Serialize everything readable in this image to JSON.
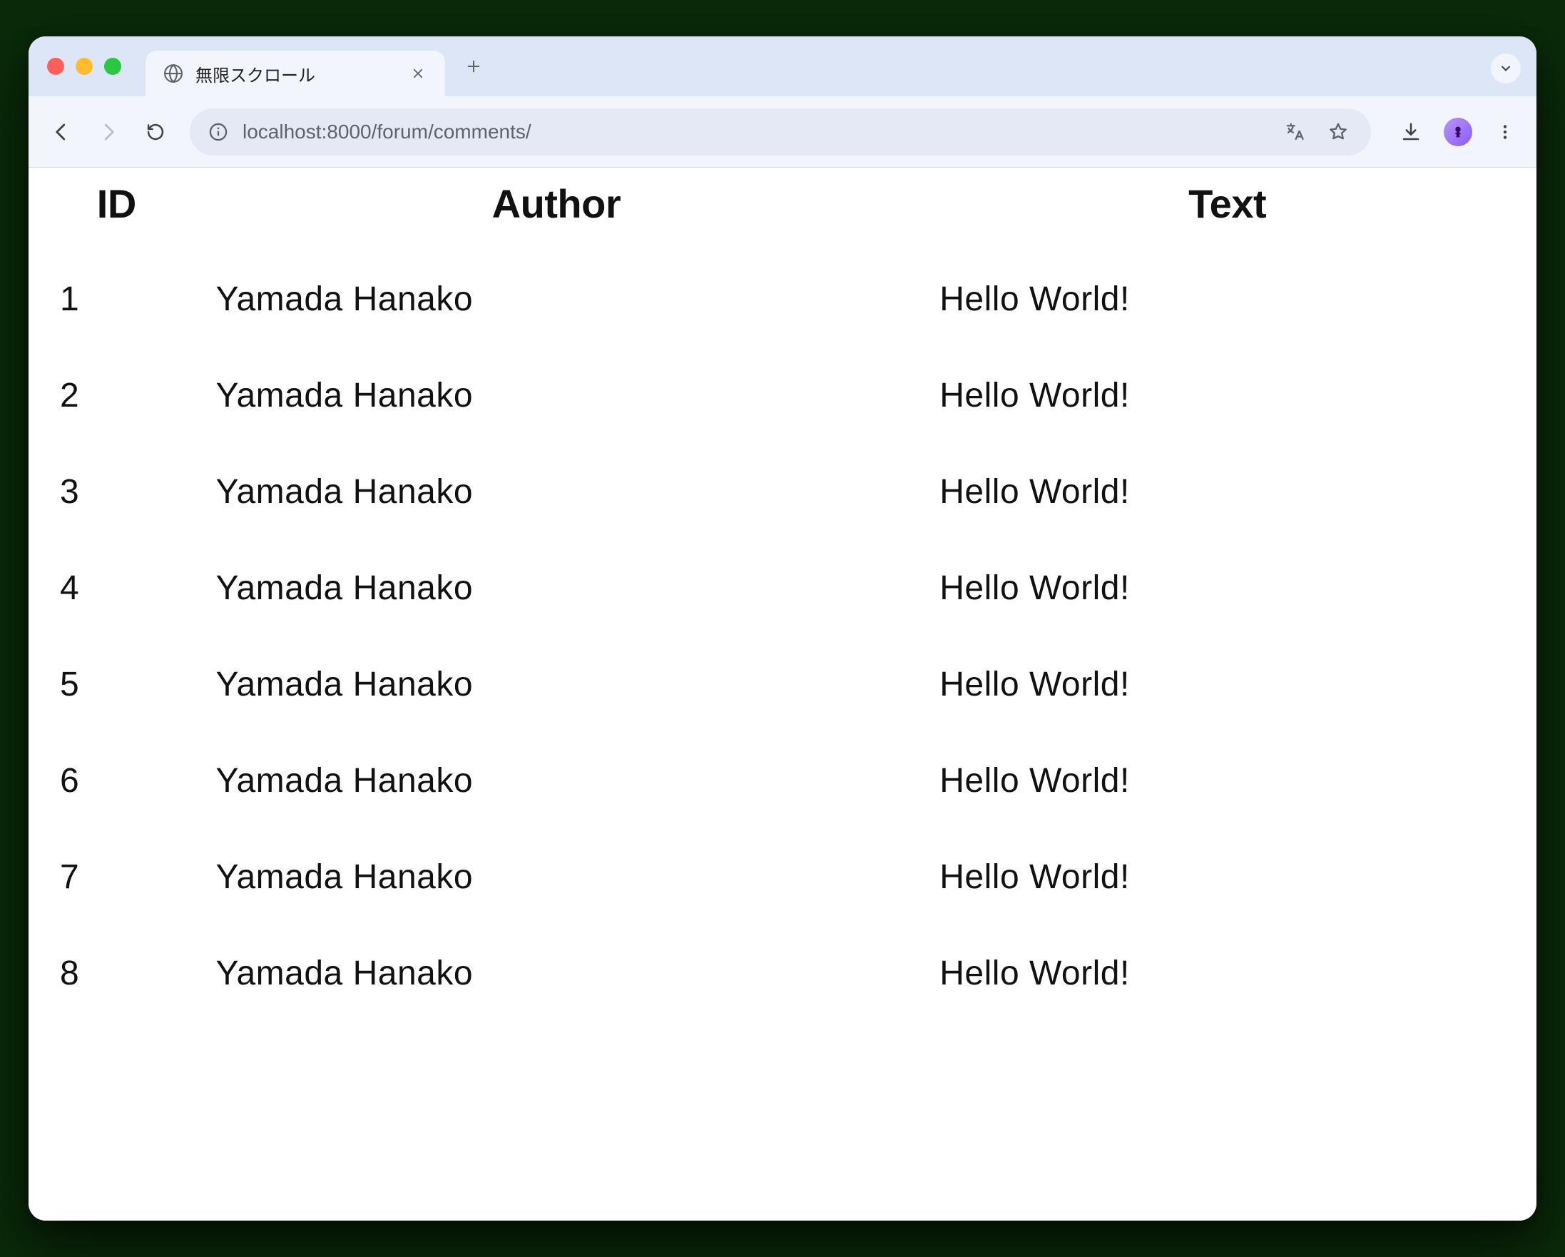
{
  "browser": {
    "tab_title": "無限スクロール",
    "url_host": "localhost:",
    "url_port_path": "8000/forum/comments/"
  },
  "table": {
    "headers": {
      "id": "ID",
      "author": "Author",
      "text": "Text"
    },
    "rows": [
      {
        "id": "1",
        "author": "Yamada Hanako",
        "text": "Hello World!"
      },
      {
        "id": "2",
        "author": "Yamada Hanako",
        "text": "Hello World!"
      },
      {
        "id": "3",
        "author": "Yamada Hanako",
        "text": "Hello World!"
      },
      {
        "id": "4",
        "author": "Yamada Hanako",
        "text": "Hello World!"
      },
      {
        "id": "5",
        "author": "Yamada Hanako",
        "text": "Hello World!"
      },
      {
        "id": "6",
        "author": "Yamada Hanako",
        "text": "Hello World!"
      },
      {
        "id": "7",
        "author": "Yamada Hanako",
        "text": "Hello World!"
      },
      {
        "id": "8",
        "author": "Yamada Hanako",
        "text": "Hello World!"
      }
    ]
  }
}
